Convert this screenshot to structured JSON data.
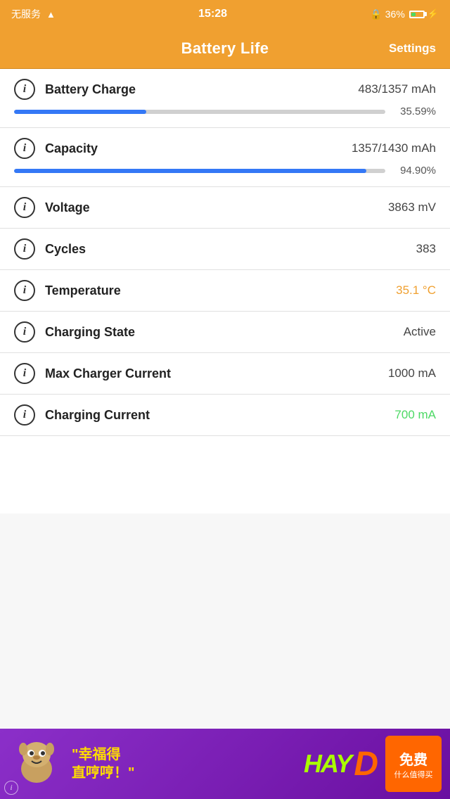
{
  "statusBar": {
    "carrier": "无服务",
    "wifi": "WiFi",
    "time": "15:28",
    "lock": "🔒",
    "battery_pct": "36%"
  },
  "navBar": {
    "title": "Battery Life",
    "settings_label": "Settings"
  },
  "rows": [
    {
      "id": "battery-charge",
      "label": "Battery Charge",
      "value": "483/1357 mAh",
      "value_color": "normal",
      "has_progress": true,
      "progress_pct": 35.59,
      "progress_pct_label": "35.59%"
    },
    {
      "id": "capacity",
      "label": "Capacity",
      "value": "1357/1430 mAh",
      "value_color": "normal",
      "has_progress": true,
      "progress_pct": 94.9,
      "progress_pct_label": "94.90%"
    },
    {
      "id": "voltage",
      "label": "Voltage",
      "value": "3863 mV",
      "value_color": "normal",
      "has_progress": false
    },
    {
      "id": "cycles",
      "label": "Cycles",
      "value": "383",
      "value_color": "normal",
      "has_progress": false
    },
    {
      "id": "temperature",
      "label": "Temperature",
      "value": "35.1 °C",
      "value_color": "orange",
      "has_progress": false
    },
    {
      "id": "charging-state",
      "label": "Charging State",
      "value": "Active",
      "value_color": "normal",
      "has_progress": false
    },
    {
      "id": "max-charger-current",
      "label": "Max Charger Current",
      "value": "1000 mA",
      "value_color": "normal",
      "has_progress": false
    },
    {
      "id": "charging-current",
      "label": "Charging Current",
      "value": "700 mA",
      "value_color": "green",
      "has_progress": false
    }
  ],
  "ad": {
    "text_line1": "\"幸福得",
    "text_line2": "直哼哼！\"",
    "logo_hay": "HAY",
    "logo_d": "D",
    "free_label": "免费",
    "sub_label": "什么值得买"
  }
}
